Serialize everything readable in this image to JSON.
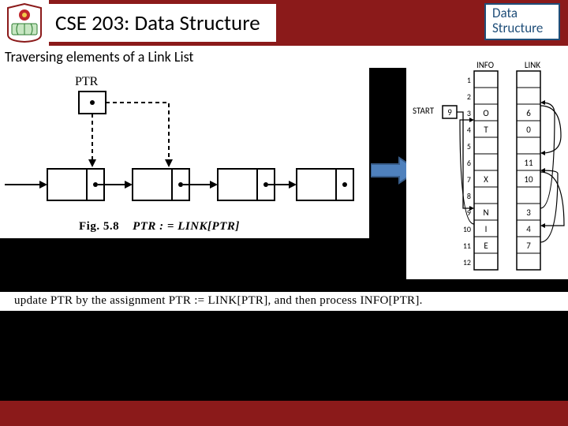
{
  "header": {
    "title": "CSE 203: Data Structure",
    "badge_line1": "Data",
    "badge_line2": "Structure"
  },
  "subheader": "Traversing elements of a Link List",
  "figure_left": {
    "ptr_label": "PTR",
    "caption_label": "Fig. 5.8",
    "caption_expr": "PTR : = LINK[PTR]"
  },
  "figure_right": {
    "start_label": "START",
    "start_value": "9",
    "col_info": "INFO",
    "col_link": "LINK",
    "rows": [
      {
        "idx": "1",
        "info": "",
        "link": ""
      },
      {
        "idx": "2",
        "info": "",
        "link": ""
      },
      {
        "idx": "3",
        "info": "O",
        "link": "6"
      },
      {
        "idx": "4",
        "info": "T",
        "link": "0"
      },
      {
        "idx": "5",
        "info": "",
        "link": ""
      },
      {
        "idx": "6",
        "info": "",
        "link": "11"
      },
      {
        "idx": "7",
        "info": "X",
        "link": "10"
      },
      {
        "idx": "8",
        "info": "",
        "link": ""
      },
      {
        "idx": "9",
        "info": "N",
        "link": "3"
      },
      {
        "idx": "10",
        "info": "I",
        "link": "4"
      },
      {
        "idx": "11",
        "info": "E",
        "link": "7"
      },
      {
        "idx": "12",
        "info": "",
        "link": ""
      }
    ]
  },
  "lower_text": "update PTR by the assignment PTR := LINK[PTR], and then process INFO[PTR].",
  "colors": {
    "header_bg": "#8b1a1a",
    "badge_border": "#1f4e79",
    "arrow_fill": "#4f81bd"
  }
}
